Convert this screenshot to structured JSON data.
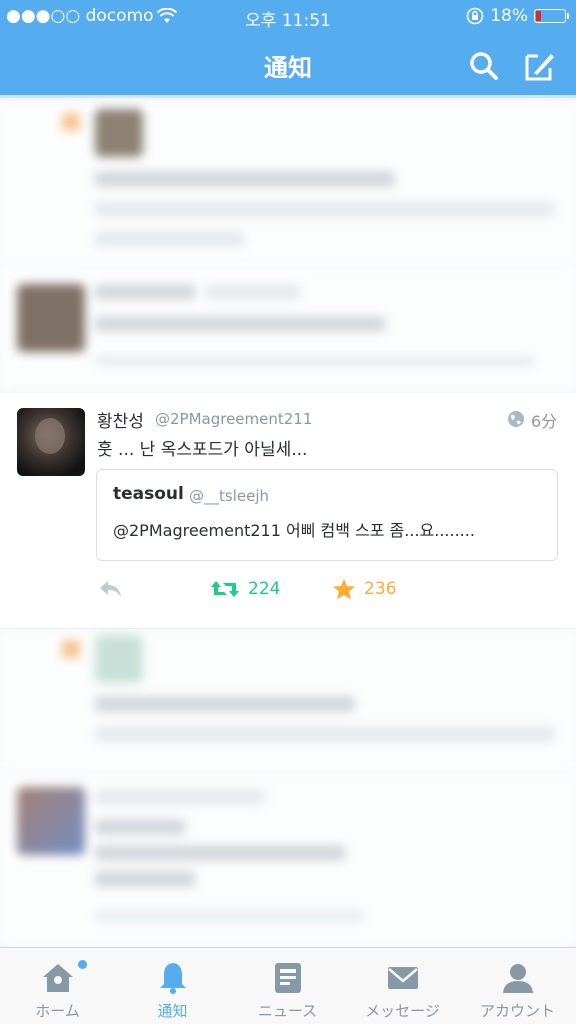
{
  "status_bar": {
    "carrier": "●●●○○ docomo",
    "time": "오후 11:51",
    "battery": "18%",
    "battery_level": 0.18
  },
  "header": {
    "title": "通知",
    "icons": [
      "search-icon",
      "compose-icon"
    ]
  },
  "tweet": {
    "name": "황찬성",
    "handle": "@2PMagreement211",
    "time": "6分",
    "text": "훗 ... 난 옥스포드가 아닐세...",
    "quote": {
      "name": "teasoul",
      "handle": "@__tsleejh",
      "text": "@2PMagreement211 어삐 컴백 스포 좀...요........"
    },
    "retweets": "224",
    "favorites": "236"
  },
  "tabs": [
    {
      "label": "ホーム",
      "icon": "home-icon",
      "active": false
    },
    {
      "label": "通知",
      "icon": "bell-icon",
      "active": true
    },
    {
      "label": "ニュース",
      "icon": "news-icon",
      "active": false
    },
    {
      "label": "メッセージ",
      "icon": "envelope-icon",
      "active": false
    },
    {
      "label": "アカウント",
      "icon": "person-icon",
      "active": false
    }
  ],
  "colors": {
    "brand": "#55acee",
    "retweet": "#19cf86",
    "favorite": "#ffac33",
    "muted": "#8899a6"
  }
}
